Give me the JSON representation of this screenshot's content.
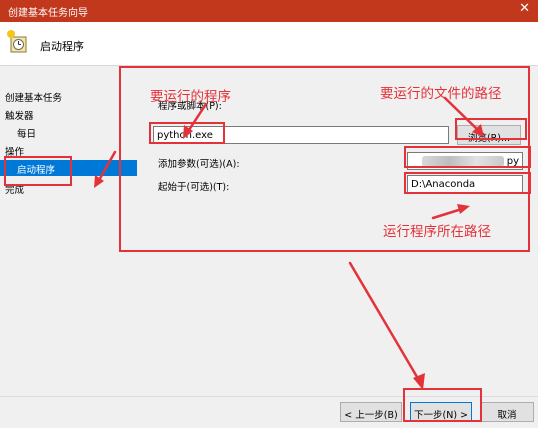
{
  "window": {
    "title": "创建基本任务向导",
    "close_glyph": "✕"
  },
  "header": {
    "title": "启动程序"
  },
  "sidebar": {
    "items": [
      {
        "label": "创建基本任务"
      },
      {
        "label": "触发器"
      },
      {
        "label": "每日"
      },
      {
        "label": "操作"
      },
      {
        "label": "启动程序"
      },
      {
        "label": "完成"
      }
    ]
  },
  "form": {
    "program_label": "程序或脚本(P):",
    "program_value": "python.exe",
    "browse_label": "浏览(R)...",
    "args_label": "添加参数(可选)(A):",
    "args_value_visible": "py",
    "start_label": "起始于(可选)(T):",
    "start_value": "D:\\Anaconda"
  },
  "footer": {
    "back_label": "< 上一步(B)",
    "next_label": "下一步(N) >",
    "cancel_label": "取消"
  },
  "annotations": {
    "program_note": "要运行的程序",
    "file_path_note": "要运行的文件的路径",
    "start_path_note": "运行程序所在路径"
  },
  "colors": {
    "titlebar": "#c1381c",
    "annotation": "#e4323a",
    "selection": "#0078d7"
  }
}
